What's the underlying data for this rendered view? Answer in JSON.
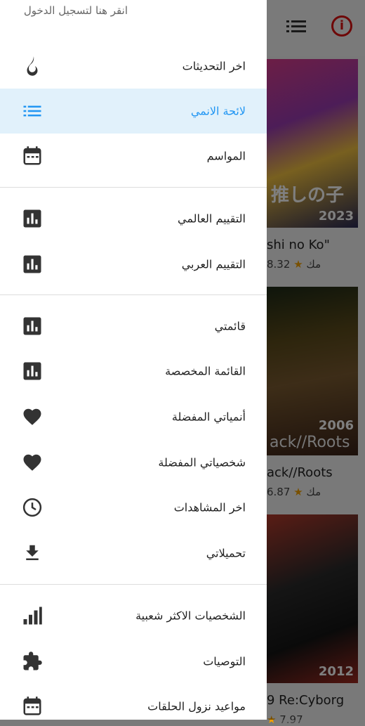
{
  "background": {
    "toolbar": {
      "list_icon": "list-icon",
      "info_icon": "info-icon"
    },
    "cards": [
      {
        "title": "shi no Ko\"",
        "rating": "8.32",
        "rating_label": "مك",
        "year": "2023",
        "poster_text": "推しの子"
      },
      {
        "title": "ack//Roots",
        "rating": "6.87",
        "rating_label": "مك",
        "year": "2006",
        "poster_text": "ack//Roots"
      },
      {
        "title": "9 Re:Cyborg",
        "rating": "7.97",
        "rating_label": "",
        "year": "2012",
        "poster_text": ""
      }
    ]
  },
  "drawer": {
    "login_text": "انقر هنا لتسجيل الدخول",
    "items": [
      {
        "label": "اخر التحديثات",
        "icon": "fire-icon",
        "active": false
      },
      {
        "label": "لائحة الانمي",
        "icon": "list-icon",
        "active": true
      },
      {
        "label": "المواسم",
        "icon": "calendar-icon",
        "active": false
      },
      {
        "label": "التقييم العالمي",
        "icon": "bar-chart-icon",
        "active": false
      },
      {
        "label": "التقييم العربي",
        "icon": "bar-chart-icon",
        "active": false
      },
      {
        "label": "قائمتي",
        "icon": "bar-chart-icon",
        "active": false
      },
      {
        "label": "القائمة المخصصة",
        "icon": "bar-chart-icon",
        "active": false
      },
      {
        "label": "أنمياتي المفضلة",
        "icon": "heart-icon",
        "active": false
      },
      {
        "label": "شخصياتي المفضلة",
        "icon": "heart-icon",
        "active": false
      },
      {
        "label": "اخر المشاهدات",
        "icon": "clock-icon",
        "active": false
      },
      {
        "label": "تحميلاتي",
        "icon": "download-icon",
        "active": false
      },
      {
        "label": "الشخصيات الاكثر شعبية",
        "icon": "signal-icon",
        "active": false
      },
      {
        "label": "التوصيات",
        "icon": "puzzle-icon",
        "active": false
      },
      {
        "label": "مواعيد نزول الحلقات",
        "icon": "calendar-icon",
        "active": false
      }
    ]
  },
  "colors": {
    "accent": "#2196f3",
    "active_bg": "#e1f1fb",
    "icon": "#333333",
    "star": "#f2a000"
  }
}
